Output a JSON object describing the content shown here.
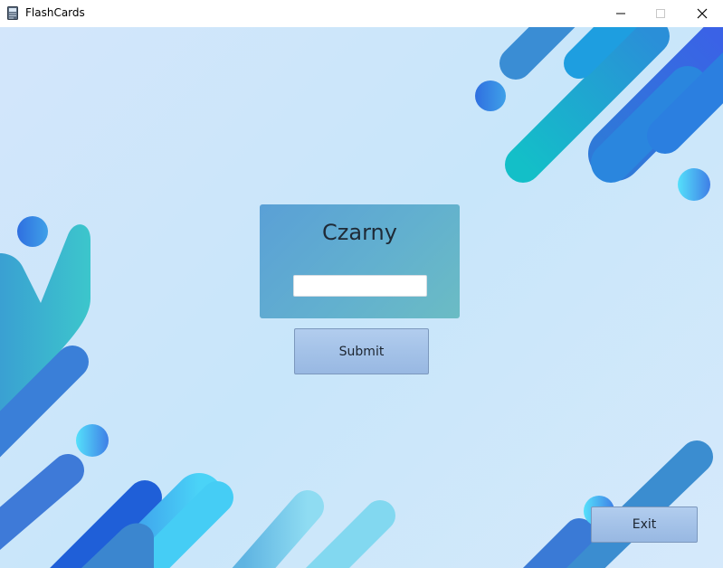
{
  "window": {
    "title": "FlashCards",
    "app_icon": "flashcards-app-icon",
    "controls": {
      "minimize_icon": "minimize-icon",
      "maximize_icon": "maximize-icon",
      "close_icon": "close-icon"
    }
  },
  "card": {
    "word": "Czarny",
    "answer": {
      "value": "",
      "placeholder": ""
    }
  },
  "buttons": {
    "submit_label": "Submit",
    "exit_label": "Exit"
  },
  "colors": {
    "background_light": "#d3e6fb",
    "card_left": "#5aa0d6",
    "card_right": "#6bbcc4",
    "button_fill": "#a4c2e8",
    "decor_blue": "#3a6fe0",
    "decor_teal": "#16c1c9",
    "decor_cyan": "#55dcf8"
  }
}
